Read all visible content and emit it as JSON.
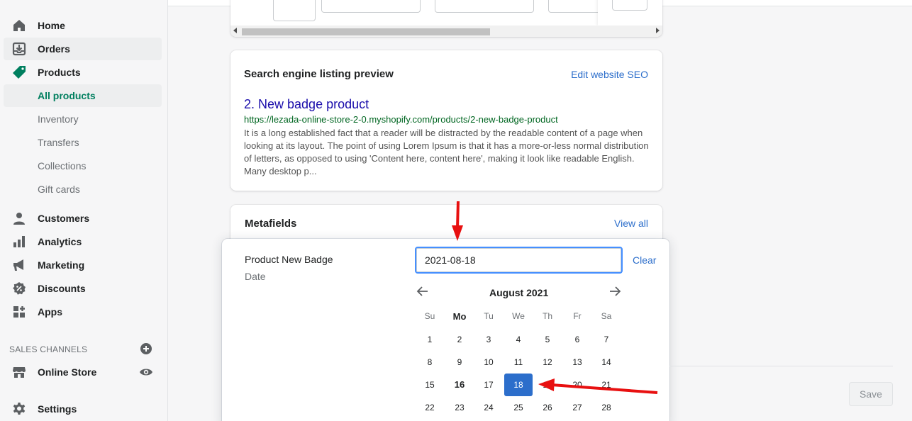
{
  "sidebar": {
    "items": [
      {
        "label": "Home",
        "icon": "home-icon"
      },
      {
        "label": "Orders",
        "icon": "orders-icon"
      },
      {
        "label": "Products",
        "icon": "tag-icon"
      },
      {
        "label": "Customers",
        "icon": "person-icon"
      },
      {
        "label": "Analytics",
        "icon": "bar-chart-icon"
      },
      {
        "label": "Marketing",
        "icon": "megaphone-icon"
      },
      {
        "label": "Discounts",
        "icon": "discount-icon"
      },
      {
        "label": "Apps",
        "icon": "apps-icon"
      }
    ],
    "product_subitems": [
      "All products",
      "Inventory",
      "Transfers",
      "Collections",
      "Gift cards"
    ],
    "sales_channels_title": "SALES CHANNELS",
    "online_store": "Online Store",
    "settings": "Settings"
  },
  "seo": {
    "title": "Search engine listing preview",
    "edit_link": "Edit website SEO",
    "page_title": "2. New badge product",
    "url": "https://lezada-online-store-2-0.myshopify.com/products/2-new-badge-product",
    "description": "It is a long established fact that a reader will be distracted by the readable content of a page when looking at its layout. The point of using Lorem Ipsum is that it has a more-or-less normal distribution of letters, as opposed to using 'Content here, content here', making it look like readable English. Many desktop p..."
  },
  "metafields": {
    "title": "Metafields",
    "view_all": "View all",
    "field_label": "Product New Badge",
    "field_type": "Date",
    "input_value": "2021-08-18",
    "clear": "Clear"
  },
  "calendar": {
    "month": "August 2021",
    "weekdays": [
      "Su",
      "Mo",
      "Tu",
      "We",
      "Th",
      "Fr",
      "Sa"
    ],
    "weeks": [
      [
        "1",
        "2",
        "3",
        "4",
        "5",
        "6",
        "7"
      ],
      [
        "8",
        "9",
        "10",
        "11",
        "12",
        "13",
        "14"
      ],
      [
        "15",
        "16",
        "17",
        "18",
        "19",
        "20",
        "21"
      ],
      [
        "22",
        "23",
        "24",
        "25",
        "26",
        "27",
        "28"
      ]
    ],
    "selected": "18",
    "today": "16"
  },
  "save_label": "Save",
  "colors": {
    "accent": "#2c6ecb",
    "active_green": "#007f5f",
    "annotation_red": "#e81010"
  }
}
